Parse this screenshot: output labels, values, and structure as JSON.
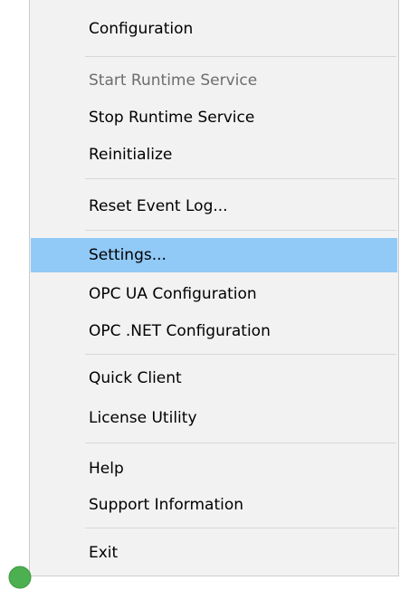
{
  "menu": {
    "items": [
      {
        "label": "Configuration",
        "enabled": true,
        "highlighted": false
      },
      {
        "label": "Start Runtime Service",
        "enabled": false,
        "highlighted": false
      },
      {
        "label": "Stop Runtime Service",
        "enabled": true,
        "highlighted": false
      },
      {
        "label": "Reinitialize",
        "enabled": true,
        "highlighted": false
      },
      {
        "label": "Reset Event Log...",
        "enabled": true,
        "highlighted": false
      },
      {
        "label": "Settings...",
        "enabled": true,
        "highlighted": true
      },
      {
        "label": "OPC UA Configuration",
        "enabled": true,
        "highlighted": false
      },
      {
        "label": "OPC .NET Configuration",
        "enabled": true,
        "highlighted": false
      },
      {
        "label": "Quick Client",
        "enabled": true,
        "highlighted": false
      },
      {
        "label": "License Utility",
        "enabled": true,
        "highlighted": false
      },
      {
        "label": "Help",
        "enabled": true,
        "highlighted": false
      },
      {
        "label": "Support Information",
        "enabled": true,
        "highlighted": false
      },
      {
        "label": "Exit",
        "enabled": true,
        "highlighted": false
      }
    ]
  },
  "colors": {
    "menu_background": "#f2f2f2",
    "highlight": "#91c9f7",
    "disabled_text": "#6d6d6d",
    "separator": "#d7d7d7",
    "tray_icon": "#4caf50"
  },
  "icons": {
    "tray_icon": "green-circle-icon"
  }
}
